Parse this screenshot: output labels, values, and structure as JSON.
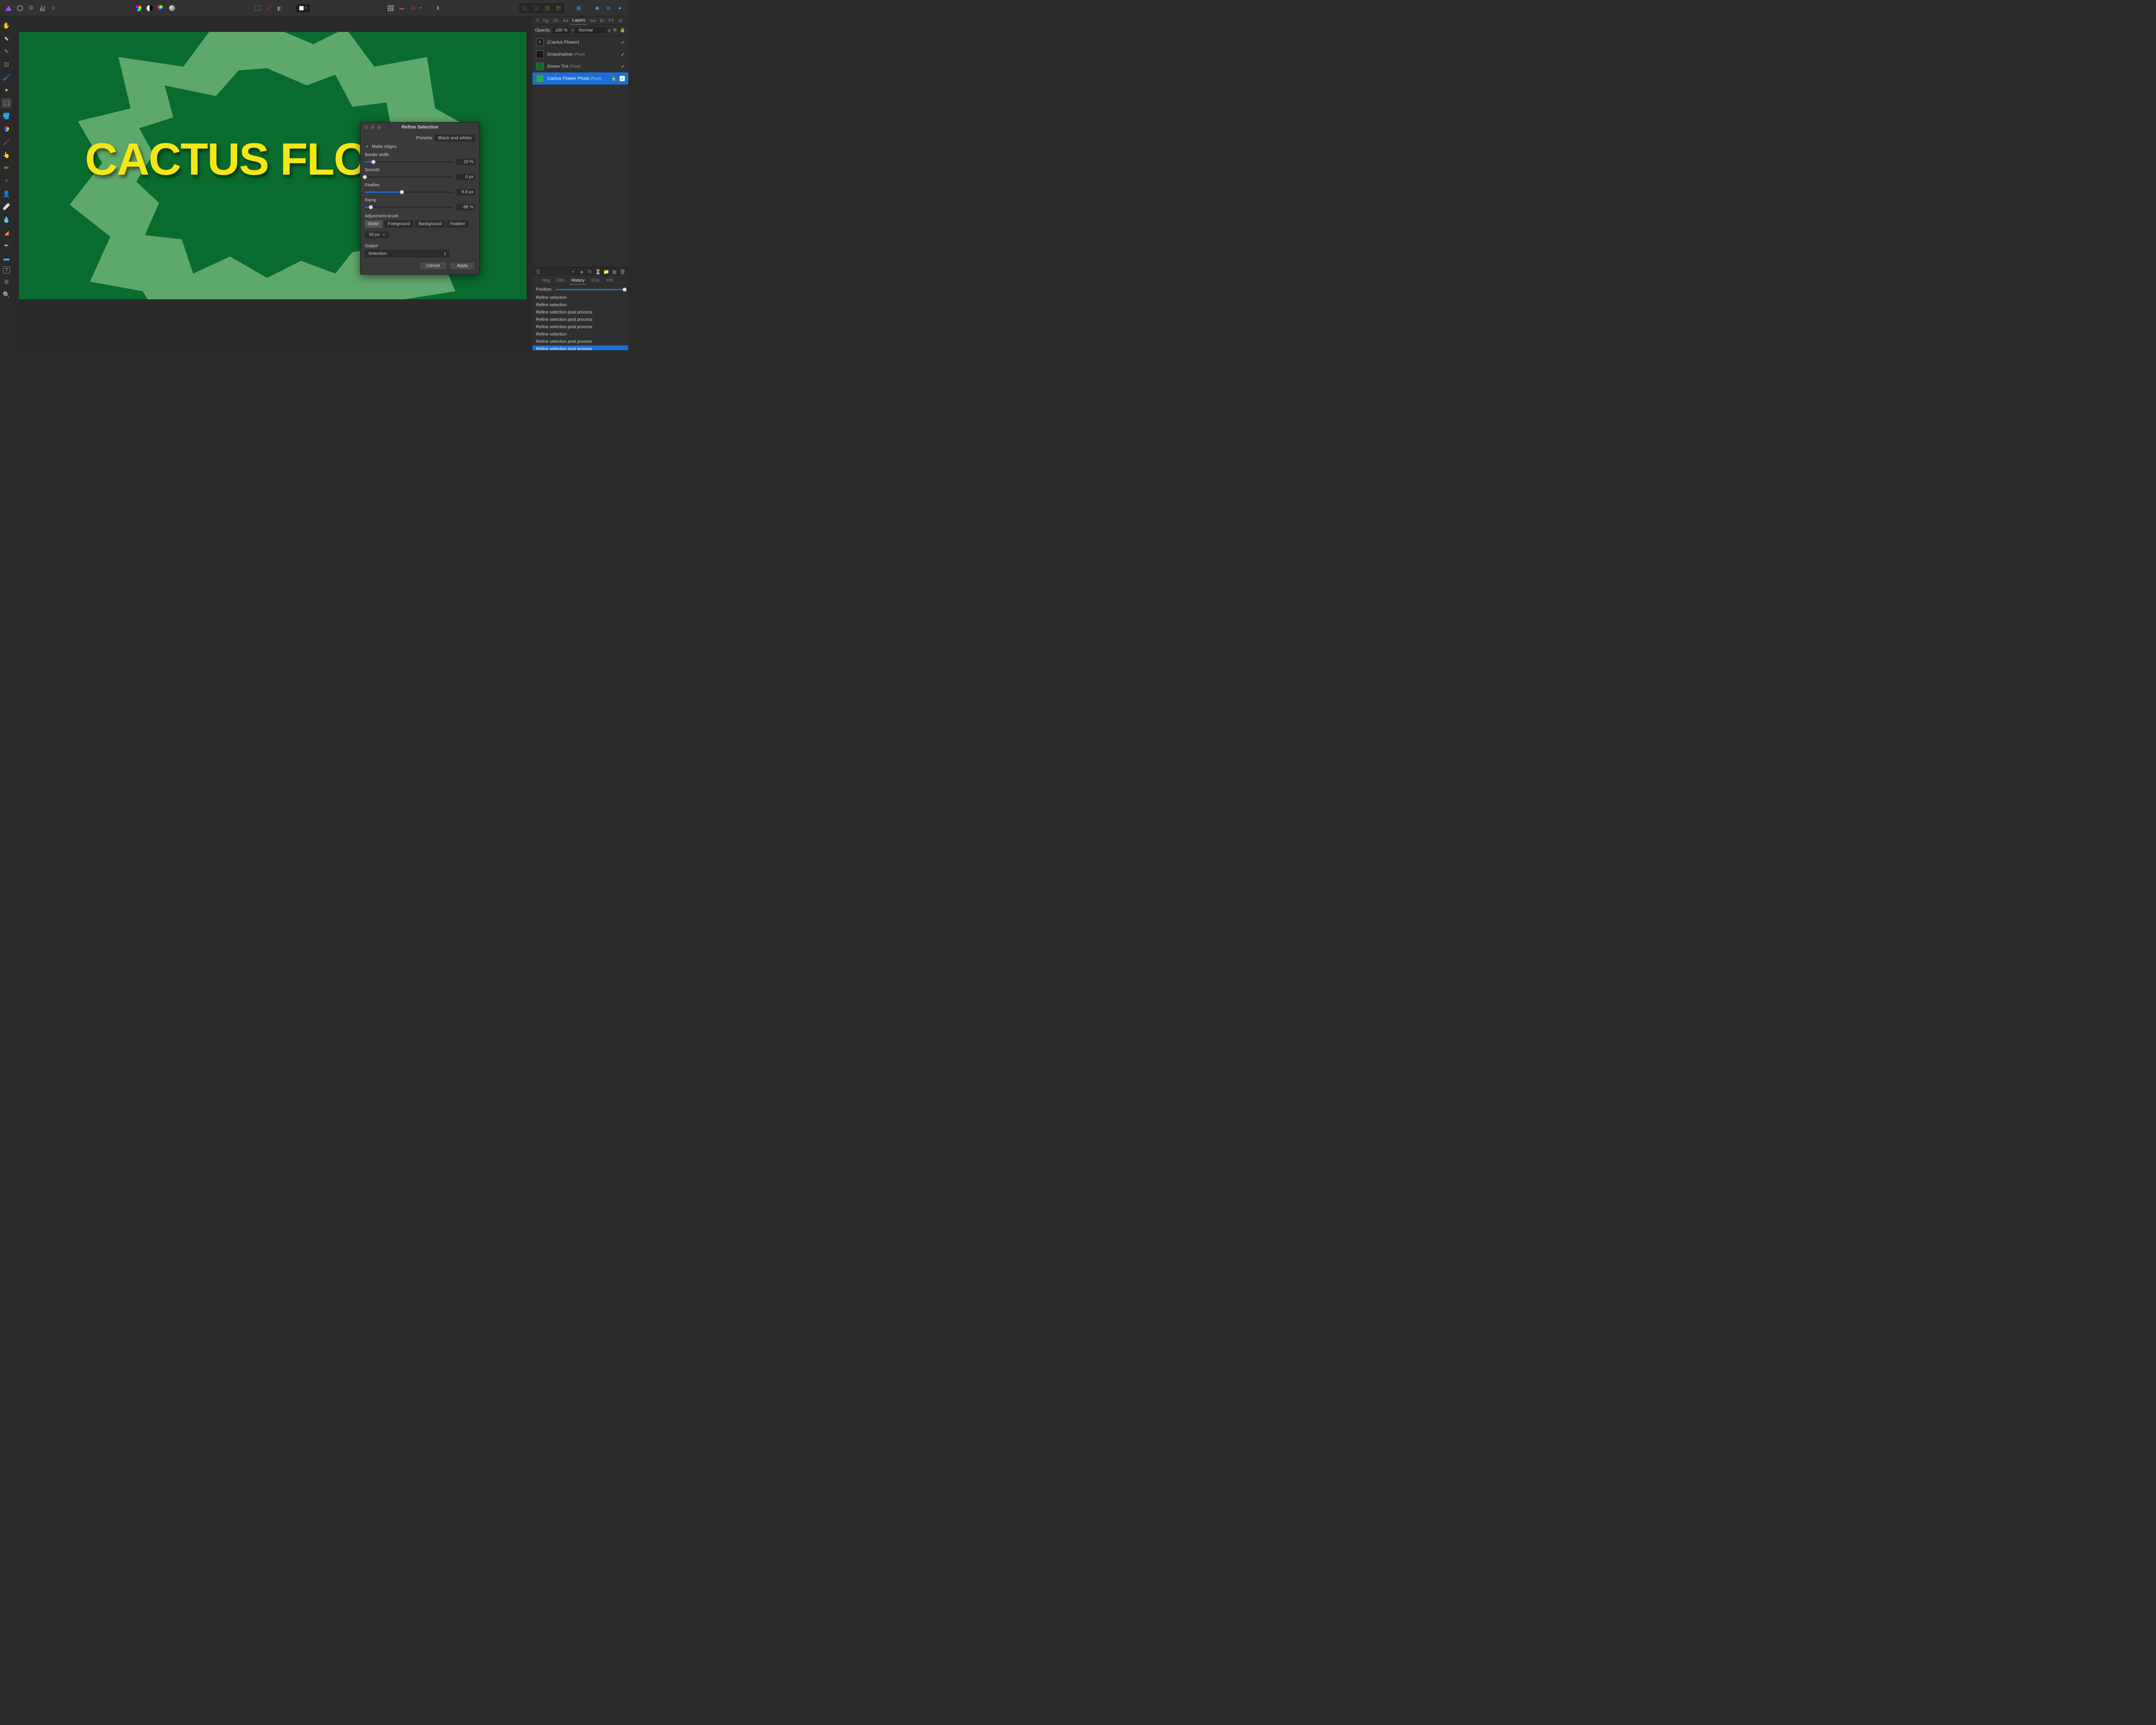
{
  "toolbar": {
    "opacity_label": "Opacity:",
    "opacity_value": "100 %",
    "blend_mode": "Normal"
  },
  "panel_tabs": [
    "II",
    "Hg",
    "Clr",
    "Ad",
    "Layers",
    "Sw",
    "Br",
    "FX",
    "St"
  ],
  "layers": [
    {
      "name": "(Cactus Flower)",
      "type": "",
      "thumb": "#222"
    },
    {
      "name": "Dropshadow",
      "type": "(Pixel)",
      "thumb": "#211"
    },
    {
      "name": "Green Tint",
      "type": "(Pixel)",
      "thumb": "#0a6b2e"
    },
    {
      "name": "Cactus Flower Photo",
      "type": "(Pixel)",
      "thumb": "#2a5",
      "selected": true,
      "locked": true
    }
  ],
  "history_tabs": [
    "Nvg",
    "Xfm",
    "History",
    "Chn",
    "Info"
  ],
  "position_label": "Position:",
  "history": [
    "Refine selection",
    "Refine selection",
    "Refine selection post process",
    "Refine selection post process",
    "Refine selection post process",
    "Refine selection",
    "Refine selection post process",
    "Refine selection post process"
  ],
  "canvas_text": "CACTUS FLOWER",
  "dialog": {
    "title": "Refine Selection",
    "preview_label": "Preview",
    "preview_value": "Black and white",
    "matte_edges": "Matte edges",
    "border_width_label": "Border width",
    "border_width_value": "10 %",
    "smooth_label": "Smooth",
    "smooth_value": "0 px",
    "feather_label": "Feather",
    "feather_value": "9.8 px",
    "ramp_label": "Ramp",
    "ramp_value": "-86 %",
    "adjustment_brush_label": "Adjustment brush",
    "brush_matte": "Matte",
    "brush_foreground": "Foreground",
    "brush_background": "Background",
    "brush_feather": "Feather",
    "brush_size": "50 px",
    "output_label": "Output",
    "output_value": "Selection",
    "cancel": "Cancel",
    "apply": "Apply"
  }
}
